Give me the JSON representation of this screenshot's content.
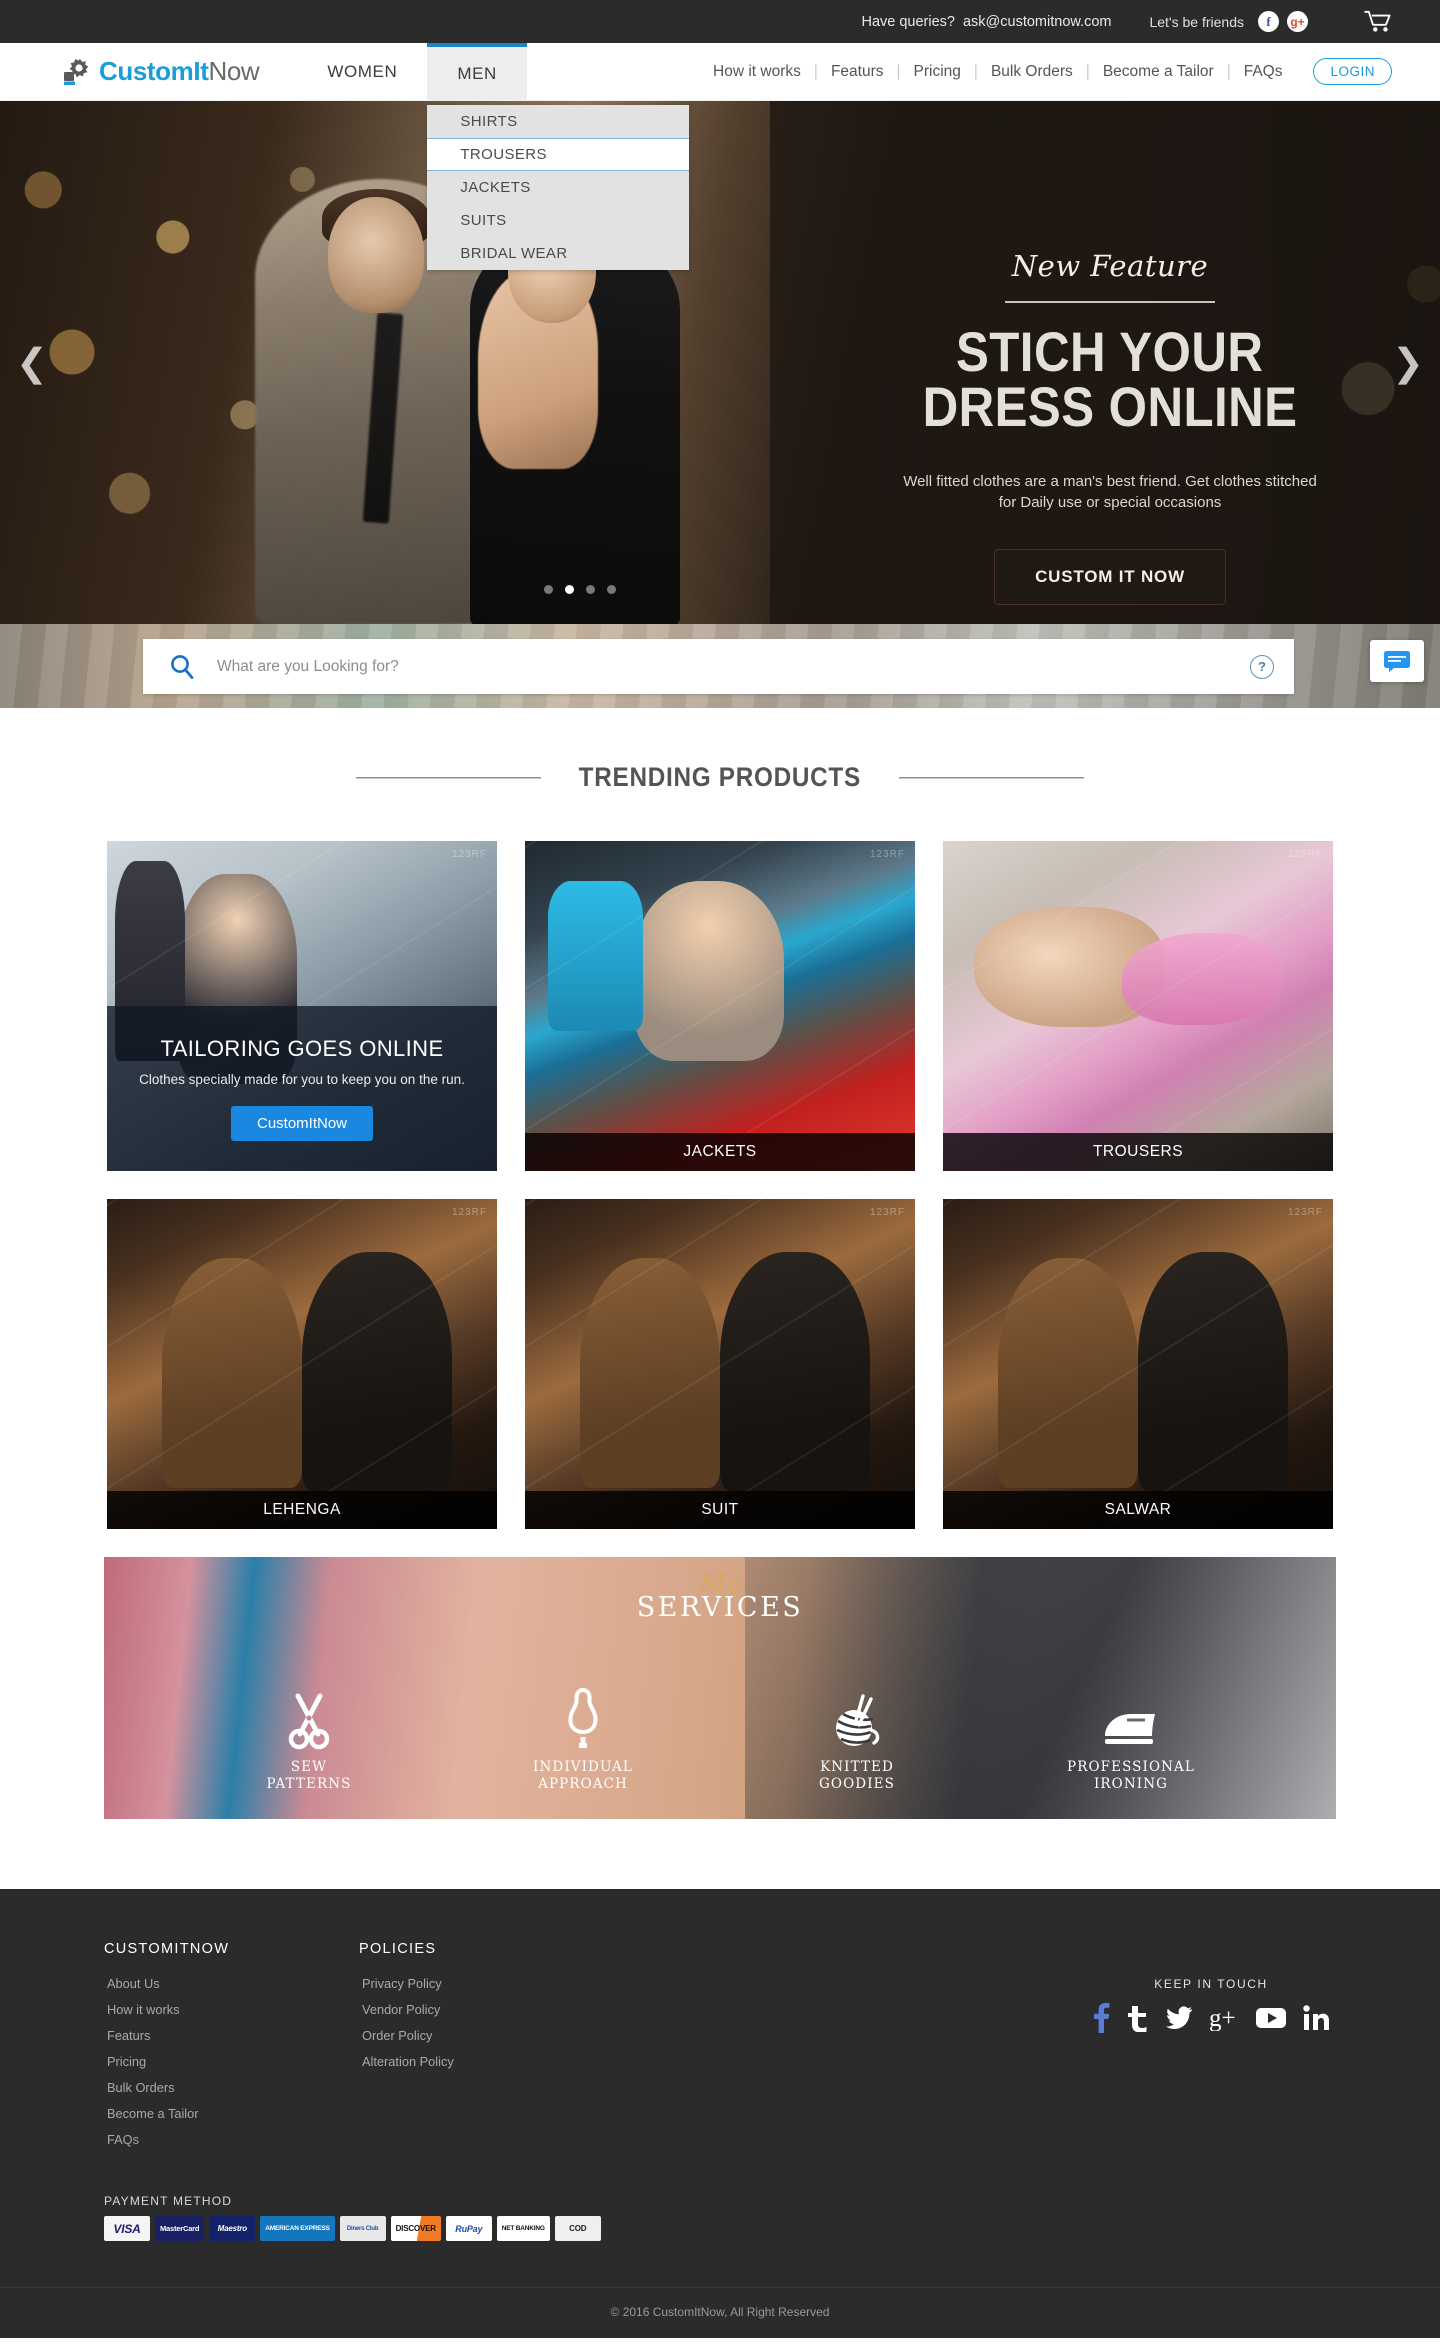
{
  "topbar": {
    "queries_label": "Have queries?",
    "email": "ask@customitnow.com",
    "friends_label": "Let's be friends",
    "facebook_glyph": "f",
    "googleplus_glyph": "g+",
    "cart_icon": "shopping-cart-icon"
  },
  "brand": {
    "name_part1": "Custom",
    "name_part2": "It",
    "name_part3": "Now",
    "accent_color": "#1a9dd9",
    "gear_icon": "gear-icon"
  },
  "nav": {
    "primary": [
      {
        "label": "WOMEN",
        "active": false
      },
      {
        "label": "MEN",
        "active": true
      }
    ],
    "dropdown": [
      {
        "label": "SHIRTS",
        "highlighted": false
      },
      {
        "label": "TROUSERS",
        "highlighted": true
      },
      {
        "label": "JACKETS",
        "highlighted": false
      },
      {
        "label": "SUITS",
        "highlighted": false
      },
      {
        "label": "BRIDAL WEAR",
        "highlighted": false
      }
    ],
    "secondary": [
      "How it works",
      "Featurs",
      "Pricing",
      "Bulk Orders",
      "Become a Tailor",
      "FAQs"
    ],
    "login_label": "LOGIN"
  },
  "hero": {
    "eyebrow": "New Feature",
    "title_line1": "STICH YOUR",
    "title_line2": "DRESS ONLINE",
    "subtitle": "Well fitted clothes are a man's best friend. Get clothes stitched for Daily use or special occasions",
    "cta_label": "CUSTOM IT NOW",
    "prev_arrow": "❮",
    "next_arrow": "❯",
    "slide_count": 4,
    "active_slide": 2
  },
  "search": {
    "placeholder": "What are you Looking for?",
    "value": "",
    "search_icon": "search-icon",
    "help_label": "?",
    "chat_icon": "chat-bubble-icon"
  },
  "trending": {
    "title": "TRENDING PRODUCTS",
    "promo": {
      "heading": "TAILORING GOES ONLINE",
      "text": "Clothes specially made for you to keep you on the run.",
      "button_label": "CustomItNow",
      "button_color": "#1a88e0"
    },
    "cards": [
      {
        "caption": "JACKETS",
        "photo": "ph-jackets"
      },
      {
        "caption": "TROUSERS",
        "photo": "ph-trousers"
      },
      {
        "caption": "LEHENGA",
        "photo": "ph-men"
      },
      {
        "caption": "SUIT",
        "photo": "ph-men"
      },
      {
        "caption": "SALWAR",
        "photo": "ph-men"
      }
    ]
  },
  "services": {
    "title_my": "My",
    "title_main": "SERVICES",
    "items": [
      {
        "label_1": "SEW",
        "label_2": "PATTERNS",
        "icon": "scissors-icon"
      },
      {
        "label_1": "INDIVIDUAL",
        "label_2": "APPROACH",
        "icon": "mannequin-icon"
      },
      {
        "label_1": "KNITTED",
        "label_2": "GOODIES",
        "icon": "yarn-ball-icon"
      },
      {
        "label_1": "PROFESSIONAL",
        "label_2": "IRONING",
        "icon": "iron-icon"
      }
    ]
  },
  "footer": {
    "col1_title": "CUSTOMITNOW",
    "col1_links": [
      "About Us",
      "How it works",
      "Featurs",
      "Pricing",
      "Bulk Orders",
      "Become a Tailor",
      "FAQs"
    ],
    "col2_title": "POLICIES",
    "col2_links": [
      "Privacy Policy",
      "Vendor Policy",
      "Order Policy",
      "Alteration Policy"
    ],
    "keep_in_touch": "KEEP IN TOUCH",
    "socials": [
      {
        "name": "facebook-icon",
        "glyph": "f",
        "color": "#5b7bd5"
      },
      {
        "name": "twitter-bird-old-icon",
        "glyph": "ť",
        "color": "#ffffff"
      },
      {
        "name": "twitter-icon",
        "glyph": "🐦",
        "color": "#ffffff"
      },
      {
        "name": "google-plus-icon",
        "glyph": "g+",
        "color": "#ffffff"
      },
      {
        "name": "youtube-icon",
        "glyph": "▶",
        "color": "#ffffff"
      },
      {
        "name": "linkedin-icon",
        "glyph": "in",
        "color": "#ffffff"
      }
    ],
    "payment_label": "PAYMENT METHOD",
    "payment_methods": [
      {
        "name": "VISA",
        "bg": "#f5f5f5",
        "fg": "#1a1f71"
      },
      {
        "name": "MasterCard",
        "bg": "#1a2066",
        "fg": "#ffffff"
      },
      {
        "name": "Maestro",
        "bg": "#14216b",
        "fg": "#ffffff"
      },
      {
        "name": "AMERICAN EXPRESS",
        "bg": "#1277bc",
        "fg": "#ffffff"
      },
      {
        "name": "Diners Club",
        "bg": "#e8e8e8",
        "fg": "#1b4f9c"
      },
      {
        "name": "DISCOVER",
        "bg": "#ffffff",
        "fg": "#111111"
      },
      {
        "name": "RuPay",
        "bg": "#ffffff",
        "fg": "#1d4b9e"
      },
      {
        "name": "NET BANKING",
        "bg": "#ffffff",
        "fg": "#111111"
      },
      {
        "name": "COD",
        "bg": "#efefef",
        "fg": "#222222"
      }
    ],
    "copyright": "© 2016 CustomItNow, All Right Reserved"
  }
}
